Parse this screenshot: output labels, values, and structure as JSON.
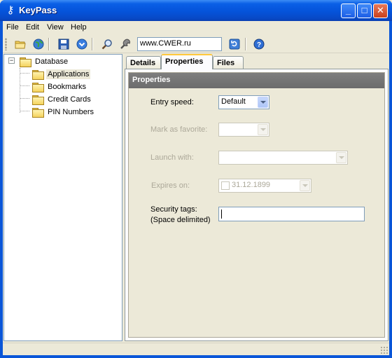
{
  "window": {
    "title": "KeyPass",
    "minimize_glyph": "_",
    "maximize_glyph": "□",
    "close_glyph": "✕",
    "title_icon_glyph": "⚷"
  },
  "menu": {
    "items": [
      "File",
      "Edit",
      "View",
      "Help"
    ]
  },
  "toolbar": {
    "url_value": "www.CWER.ru",
    "icons": [
      "open-folder-icon",
      "globe-icon",
      "save-icon",
      "download-icon",
      "search-icon",
      "tools-icon",
      "refresh-icon",
      "help-icon"
    ]
  },
  "tree": {
    "root": "Database",
    "expander_glyph": "−",
    "children": [
      "Applications",
      "Bookmarks",
      "Credit Cards",
      "PIN Numbers"
    ],
    "selected": "Applications"
  },
  "tabs": {
    "items": [
      "Details",
      "Properties",
      "Files"
    ],
    "active": "Properties"
  },
  "properties": {
    "section_title": "Properties",
    "entry_speed_label": "Entry speed:",
    "entry_speed_value": "Default",
    "favorite_label": "Mark as favorite:",
    "favorite_value": "",
    "launch_label": "Launch with:",
    "launch_value": "",
    "expires_label": "Expires on:",
    "expires_value": "31.12.1899",
    "security_tags_label_1": "Security tags:",
    "security_tags_label_2": "(Space delimited)",
    "security_tags_value": ""
  },
  "colors": {
    "titlebar": "#0553da",
    "section_header": "#757575",
    "active_tab_highlight": "#ffc83c",
    "disabled_text": "#aca899"
  }
}
